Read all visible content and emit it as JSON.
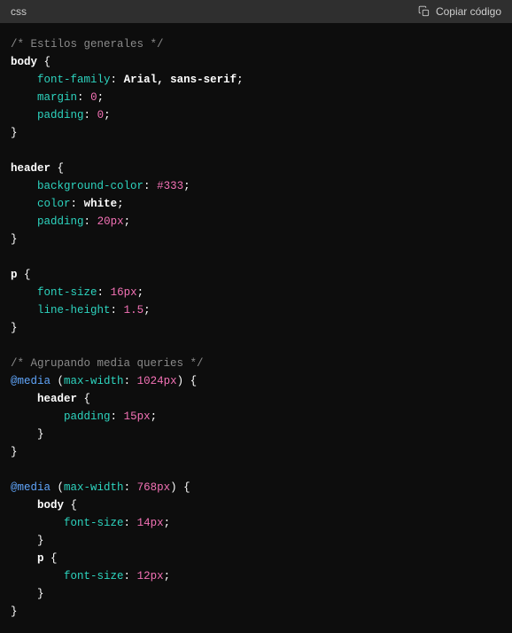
{
  "header": {
    "language": "css",
    "copy_label": "Copiar código"
  },
  "code": {
    "comment1": "/* Estilos generales */",
    "sel_body": "body",
    "brace_open": " {",
    "brace_close": "}",
    "prop_font_family": "font-family",
    "val_font_family": "Arial, sans-serif",
    "prop_margin": "margin",
    "val_zero": "0",
    "prop_padding": "padding",
    "sel_header": "header",
    "prop_bgcolor": "background-color",
    "val_bgcolor": "#333",
    "prop_color": "color",
    "val_white": "white",
    "val_20px": "20px",
    "sel_p": "p",
    "prop_font_size": "font-size",
    "val_16px": "16px",
    "prop_line_height": "line-height",
    "val_1_5": "1.5",
    "comment2": "/* Agrupando media queries */",
    "at_media": "@media",
    "mq_max_width": "max-width",
    "val_1024px": "1024px",
    "val_15px": "15px",
    "val_768px": "768px",
    "val_14px": "14px",
    "val_12px": "12px",
    "colon": ":",
    "semicolon": ";",
    "paren_open": "(",
    "paren_close": ")"
  }
}
